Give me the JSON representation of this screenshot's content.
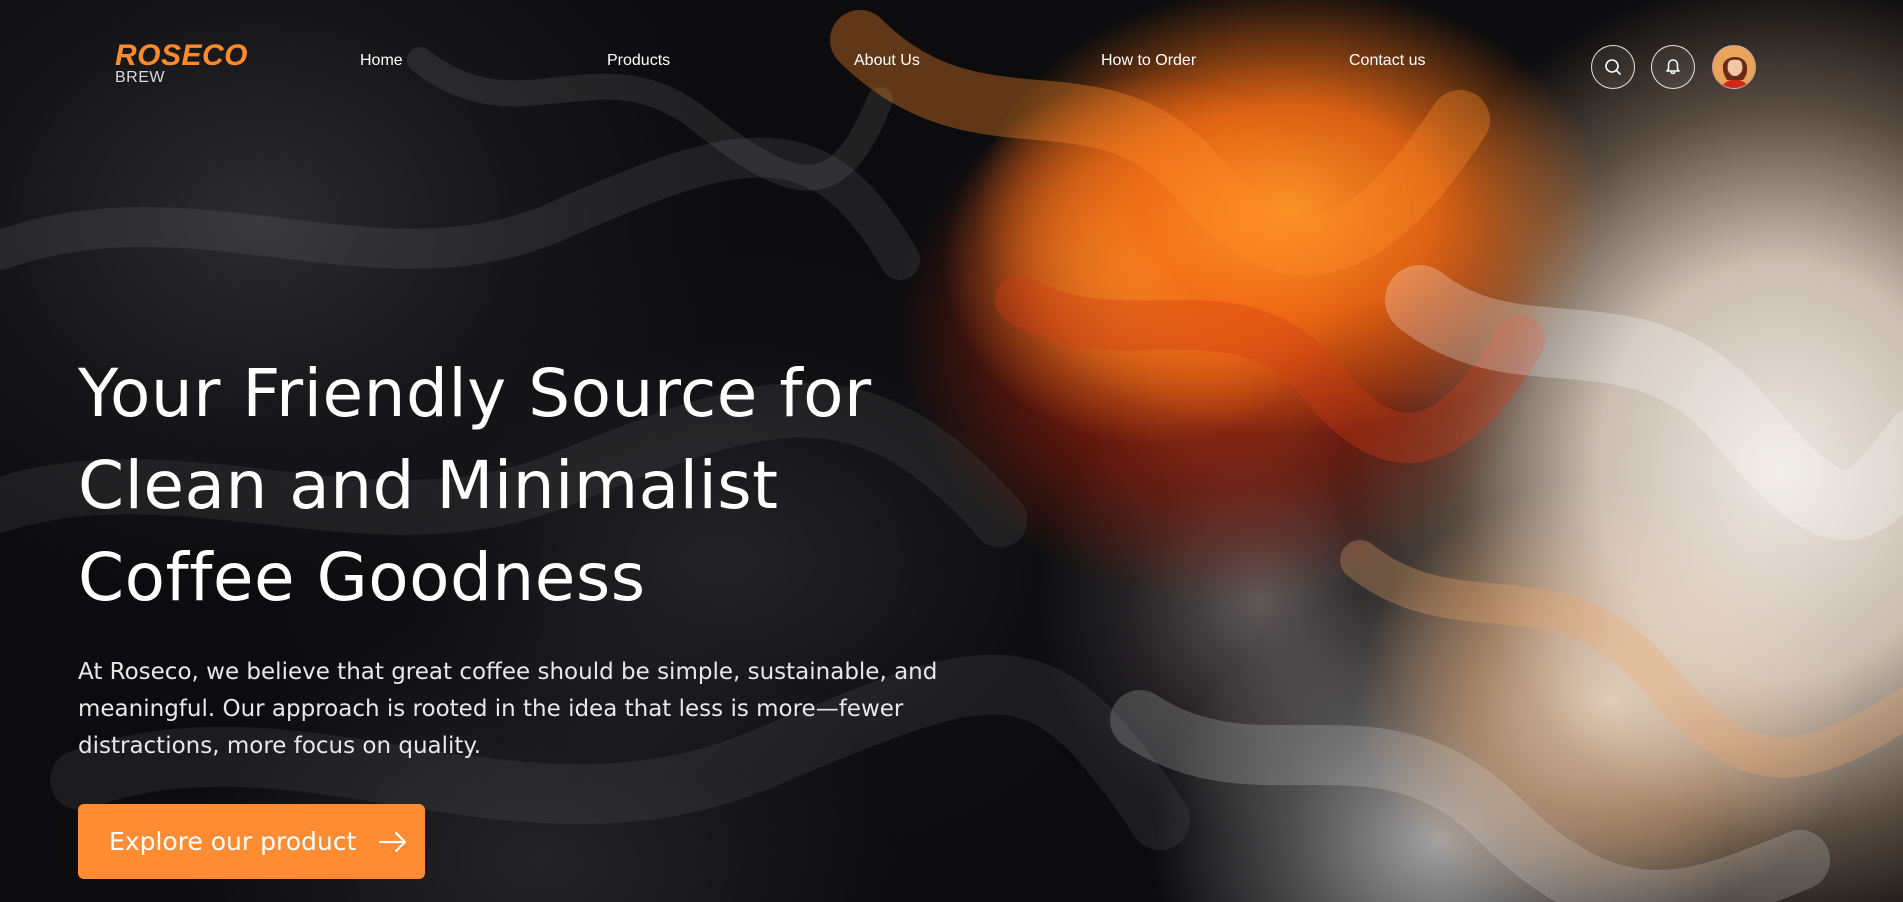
{
  "brand": {
    "name": "ROSECO",
    "sub": "BREW",
    "accent_color": "#ff8c32"
  },
  "nav": {
    "items": [
      {
        "label": "Home"
      },
      {
        "label": "Products"
      },
      {
        "label": "About Us"
      },
      {
        "label": "How to Order"
      },
      {
        "label": "Contact us"
      }
    ],
    "icons": [
      "search-icon",
      "bell-icon",
      "user-avatar"
    ]
  },
  "hero": {
    "title_lines": [
      "Your Friendly Source for",
      "Clean and Minimalist",
      "Coffee Goodness"
    ],
    "description_lines": [
      "At Roseco, we believe that great coffee should be simple, sustainable, and",
      "meaningful. Our approach is rooted in the idea that less is more—fewer",
      "distractions, more focus on quality."
    ],
    "cta_label": "Explore our product"
  }
}
